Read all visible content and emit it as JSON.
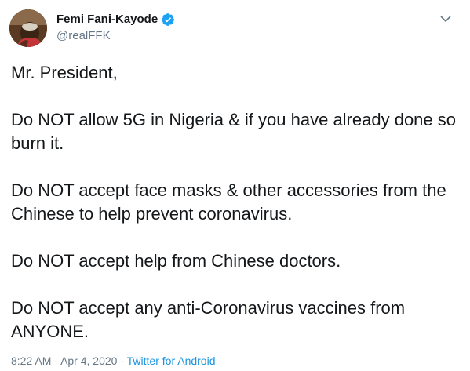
{
  "author": {
    "name": "Femi Fani-Kayode",
    "handle": "@realFFK",
    "verified": true
  },
  "menu_icon": "chevron-down-icon",
  "tweet": {
    "paragraphs": [
      "Mr. President,",
      "Do NOT allow 5G in Nigeria & if you have already done so burn it.",
      "Do NOT accept face masks & other accessories from the Chinese to help prevent coronavirus.",
      "Do NOT accept help from Chinese doctors.",
      "Do NOT accept any anti-Coronavirus vaccines from ANYONE."
    ]
  },
  "meta": {
    "time": "8:22 AM",
    "separator": "·",
    "date": "Apr 4, 2020",
    "source": "Twitter for Android"
  },
  "colors": {
    "text": "#14171a",
    "secondary": "#657786",
    "link": "#1b95e0",
    "verified": "#1da1f2"
  }
}
